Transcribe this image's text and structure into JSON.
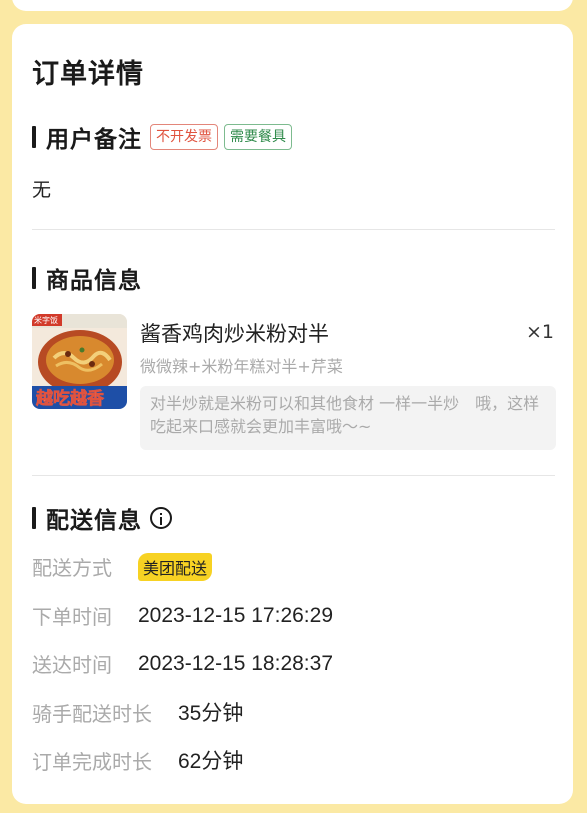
{
  "order": {
    "title": "订单详情",
    "remark": {
      "section_title": "用户备注",
      "tags": [
        "不开发票",
        "需要餐具"
      ],
      "text": "无"
    },
    "goods": {
      "section_title": "商品信息",
      "item": {
        "name": "酱香鸡肉炒米粉对半",
        "quantity": "×1",
        "spec": "微微辣+米粉年糕对半+芹菜",
        "description": "对半炒就是米粉可以和其他食材 一样一半炒　哦，这样吃起来口感就会更加丰富哦～~",
        "thumb_text_top": "米字饭",
        "thumb_text_bottom": "越吃越香"
      }
    },
    "delivery": {
      "section_title": "配送信息",
      "rows": [
        {
          "label": "配送方式",
          "value": "美团配送"
        },
        {
          "label": "下单时间",
          "value": "2023-12-15 17:26:29"
        },
        {
          "label": "送达时间",
          "value": "2023-12-15 18:28:37"
        },
        {
          "label": "骑手配送时长",
          "value": "35分钟"
        },
        {
          "label": "订单完成时长",
          "value": "62分钟"
        }
      ]
    }
  },
  "colors": {
    "background": "#fbe9a4",
    "delivery_badge": "#f7d223",
    "tag_red": "#e0533f",
    "tag_green": "#2f8a4a"
  },
  "icons": {
    "delivery_info": "info-circle-icon"
  }
}
